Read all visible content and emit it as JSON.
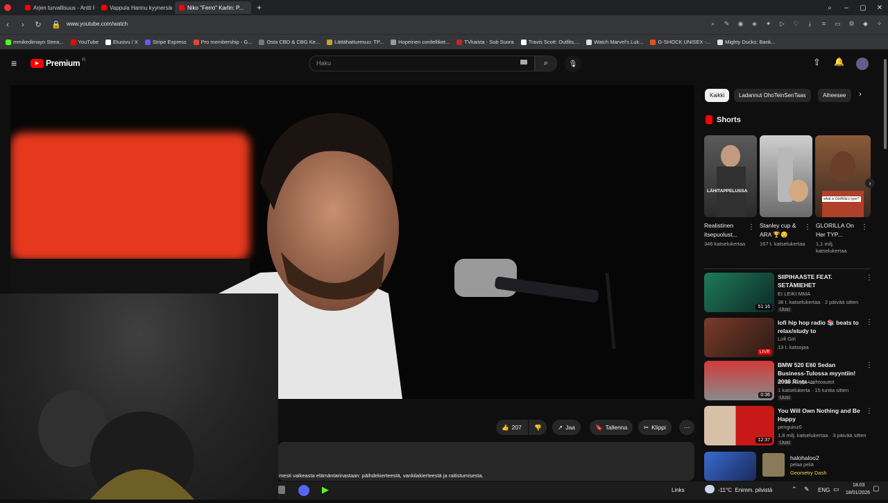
{
  "browser": {
    "tabs": [
      {
        "label": "Arjen turvallisuus - Antti P..."
      },
      {
        "label": "Vappula Hannu kyynersäu"
      },
      {
        "label": "Niko \"Ferro\" Karlin: P..."
      }
    ],
    "new_tab": "+",
    "url": "www.youtube.com/watch",
    "bookmarks": [
      {
        "label": "mmikedimayn Strea...",
        "color": "#53fc18"
      },
      {
        "label": "YouTube",
        "color": "#ff0000"
      },
      {
        "label": "Etusivu / X",
        "color": "#ffffff"
      },
      {
        "label": "Stripe Express",
        "color": "#635bff"
      },
      {
        "label": "Pro membership - G...",
        "color": "#ea4335"
      },
      {
        "label": "Osta CBD & CBG Ke...",
        "color": "#777777"
      },
      {
        "label": "Lättähatturesuu: TP...",
        "color": "#c9a227"
      },
      {
        "label": "Hopeinen cordelliket...",
        "color": "#999999"
      },
      {
        "label": "TVkaista - Sub Suora",
        "color": "#cc2222"
      },
      {
        "label": "Travis Scott: Outfits,...",
        "color": "#ffffff"
      },
      {
        "label": "Watch Marvel's Luk...",
        "color": "#dddddd"
      },
      {
        "label": "G-SHOCK UNISEX -...",
        "color": "#e8501a"
      },
      {
        "label": "Mighty Ducks: Bank...",
        "color": "#dddddd"
      }
    ]
  },
  "youtube": {
    "logo": "Premium",
    "logo_sup": "FI",
    "search_placeholder": "Haku",
    "accent": "#ff0000"
  },
  "actions": {
    "likes": "207",
    "share": "Jaa",
    "save": "Tallenna",
    "clip": "Klippi"
  },
  "description": "mesti vaikeasta elämäntarinastaan: päihdekierteestä, vankilakierteestä ja raitistumisesta.",
  "chips": [
    "Kaikki",
    "Ladannut OhoTeinSenTaas",
    "Aiheesee"
  ],
  "shorts": {
    "heading": "Shorts",
    "items": [
      {
        "title": "Realistinen itsepuolust...",
        "views": "346 katselukertaa",
        "overlay": "LÄHITAPPELUSSA"
      },
      {
        "title": "Stanley cup & ARA 🏆😏",
        "views": "167 t. katselukertaa",
        "overlay": ""
      },
      {
        "title": "GLORILLA On Her TYP...",
        "views": "1,1 milj. katselukertaa",
        "overlay": "what is GloRilla's type?"
      }
    ]
  },
  "recommendations": [
    {
      "title": "SIIPIHAASTE FEAT. SETÄMIEHET",
      "channel": "EI LEIKI MMA",
      "meta": "38 t. katselukertaa · 2 päivää sitten",
      "badge": "Uusi",
      "duration": "51:16"
    },
    {
      "title": "lofi hip hop radio 📚 beats to relax/study to",
      "channel": "Lofi Girl",
      "meta": "13 t. katsojaa",
      "badge": "",
      "duration": "LIVE"
    },
    {
      "title": "BMW 520 E60 Sedan Business-Tulossa myyntiin! 2008 Rinta-...",
      "channel": "Rinta-Jouppi Vaihtoautot",
      "meta": "1 katselukerta · 15 tuntia sitten",
      "badge": "Uusi",
      "duration": "0:36"
    },
    {
      "title": "You Will Own Nothing and Be Happy",
      "channel": "penguinz0",
      "meta": "1,8 milj. katselukertaa · 3 päivää sitten",
      "badge": "Uusi",
      "duration": "12:37"
    },
    {
      "title": "halohaloo2",
      "channel": "pelaa peliä",
      "meta": "Geometry Dash",
      "badge": "",
      "duration": ""
    }
  ],
  "taskbar": {
    "links": "Links",
    "weather": "-11°C  Enimm. pilvistä",
    "lang": "ENG",
    "time": "18.03",
    "date": "18/01/2026"
  }
}
